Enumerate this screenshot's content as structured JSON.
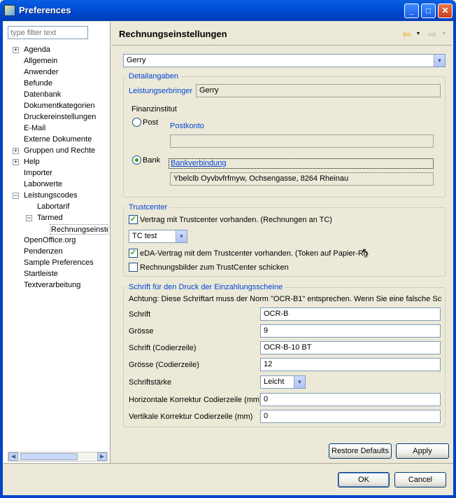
{
  "window": {
    "title": "Preferences",
    "minimize": "_",
    "maximize": "□",
    "close": "✕"
  },
  "filter": {
    "placeholder": "type filter text"
  },
  "tree": [
    {
      "label": "Agenda",
      "expand": "+"
    },
    {
      "label": "Allgemein"
    },
    {
      "label": "Anwender"
    },
    {
      "label": "Befunde"
    },
    {
      "label": "Datenbank"
    },
    {
      "label": "Dokumentkategorien"
    },
    {
      "label": "Druckereinstellungen"
    },
    {
      "label": "E-Mail"
    },
    {
      "label": "Externe Dokumente"
    },
    {
      "label": "Gruppen und Rechte",
      "expand": "+"
    },
    {
      "label": "Help",
      "expand": "+"
    },
    {
      "label": "Importer"
    },
    {
      "label": "Laborwerte"
    },
    {
      "label": "Leistungscodes",
      "expand": "−"
    },
    {
      "label": "Labortarif"
    },
    {
      "label": "Tarmed",
      "expand": "−"
    },
    {
      "label": "Rechnungseinste"
    },
    {
      "label": "OpenOffice.org"
    },
    {
      "label": "Pendenzen"
    },
    {
      "label": "Sample Preferences"
    },
    {
      "label": "Startleiste"
    },
    {
      "label": "Textverarbeitung"
    }
  ],
  "page": {
    "title": "Rechnungseinstellungen"
  },
  "nav": {
    "back": "⇦",
    "forward": "⇨",
    "dropdown": "▾"
  },
  "mandator": {
    "selected": "Gerry"
  },
  "detail": {
    "legend": "Detailangaben",
    "provider_label": "Leistungserbringer",
    "provider_value": "Gerry",
    "finance_label": "Finanzinstitut",
    "post_label": "Post",
    "post_account_label": "Postkonto",
    "post_account_value": "",
    "bank_label": "Bank",
    "bank_link_label": "Bankverbindung",
    "bank_value": "Ybelclb Oyvbvfrfmyw, Ochsengasse, 8264 Rheinau"
  },
  "trustcenter": {
    "legend": "Trustcenter",
    "contract_label": "Vertrag mit Trustcenter vorhanden. (Rechnungen an TC)",
    "contract_checked": true,
    "tc_selected": "TC test",
    "eda_label": "eDA-Vertrag mit dem Trustcenter vorhanden. (Token auf Papier-Rg",
    "eda_checked": true,
    "images_label": "Rechnungsbilder zum TrustCenter schicken",
    "images_checked": false
  },
  "font": {
    "legend": "Schrift für den Druck der Einzahlungsscheine",
    "note": "Achtung: Diese Schriftart muss der Norm \"OCR-B1\" entsprechen. Wenn Sie eine falsche Schri",
    "rows": [
      {
        "label": "Schrift",
        "value": "OCR-B"
      },
      {
        "label": "Grösse",
        "value": "9"
      },
      {
        "label": "Schrift (Codierzeile)",
        "value": "OCR-B-10 BT"
      },
      {
        "label": "Grösse (Codierzeile)",
        "value": "12"
      }
    ],
    "weight_label": "Schriftstärke",
    "weight_value": "Leicht",
    "hcorr_label": "Horizontale Korrektur Codierzeile (mm)",
    "hcorr_value": "0",
    "vcorr_label": "Vertikale Korrektur Codierzeile (mm)",
    "vcorr_value": "0"
  },
  "buttons": {
    "restore": "Restore Defaults",
    "apply": "Apply",
    "ok": "OK",
    "cancel": "Cancel"
  }
}
